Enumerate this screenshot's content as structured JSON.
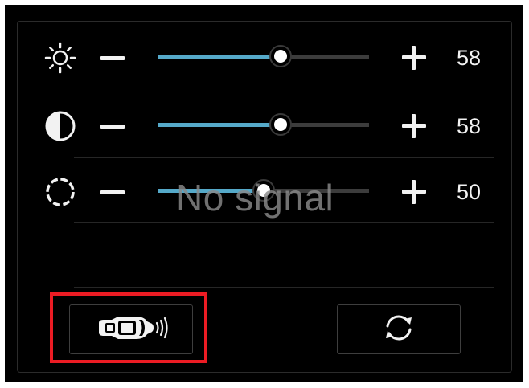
{
  "controls": [
    {
      "name": "brightness",
      "icon": "brightness-icon",
      "value": "58",
      "level": 0.58
    },
    {
      "name": "contrast",
      "icon": "contrast-icon",
      "value": "58",
      "level": 0.58
    },
    {
      "name": "saturation",
      "icon": "saturation-icon",
      "value": "50",
      "level": 0.5
    }
  ],
  "overlay": {
    "message": "No signal"
  },
  "buttons": {
    "parking_sensor": {
      "icon": "car-sensor-icon",
      "highlighted": true
    },
    "reset": {
      "icon": "refresh-icon"
    }
  },
  "colors": {
    "slider_fill": "#55a9c9",
    "slider_track": "#3c3c3c",
    "highlight": "#ec1c24",
    "background": "#000000"
  }
}
